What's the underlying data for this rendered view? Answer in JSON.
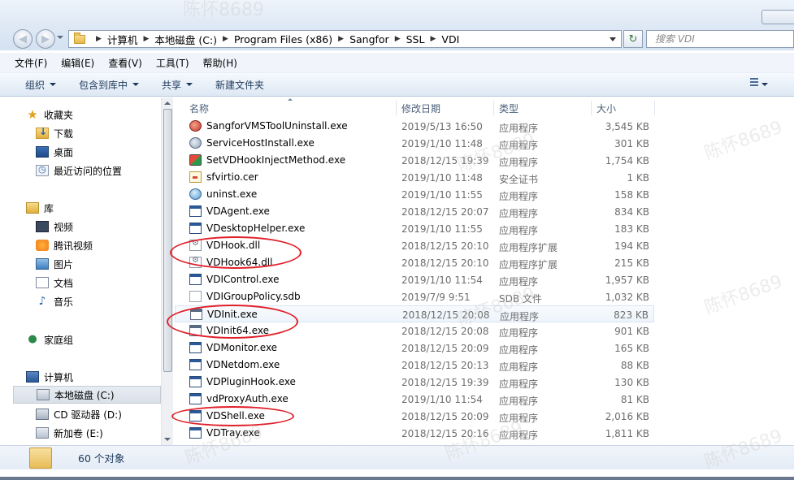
{
  "address": {
    "crumbs": [
      "计算机",
      "本地磁盘 (C:)",
      "Program Files (x86)",
      "Sangfor",
      "SSL",
      "VDI"
    ]
  },
  "search": {
    "placeholder": "搜索 VDI"
  },
  "menu": [
    "文件(F)",
    "编辑(E)",
    "查看(V)",
    "工具(T)",
    "帮助(H)"
  ],
  "toolbar": {
    "organize": "组织",
    "include_library": "包含到库中",
    "share": "共享",
    "new_folder": "新建文件夹"
  },
  "nav": {
    "favorites": "收藏夹",
    "downloads": "下载",
    "desktop": "桌面",
    "recent": "最近访问的位置",
    "libraries": "库",
    "videos": "视频",
    "tencent_video": "腾讯视频",
    "pictures": "图片",
    "documents": "文档",
    "music": "音乐",
    "homegroup": "家庭组",
    "computer": "计算机",
    "local_disk": "本地磁盘 (C:)",
    "cd_drive": "CD 驱动器 (D:)",
    "new_volume": "新加卷 (E:)"
  },
  "columns": {
    "name": "名称",
    "modified": "修改日期",
    "type": "类型",
    "size": "大小"
  },
  "files": [
    {
      "name": "SangforVMSToolUninstall.exe",
      "date": "2019/5/13 16:50",
      "type": "应用程序",
      "size": "3,545 KB",
      "icon": "app-red-icon"
    },
    {
      "name": "ServiceHostInstall.exe",
      "date": "2019/1/10 11:48",
      "type": "应用程序",
      "size": "301 KB",
      "icon": "app-gear-icon"
    },
    {
      "name": "SetVDHookInjectMethod.exe",
      "date": "2018/12/15 19:39",
      "type": "应用程序",
      "size": "1,754 KB",
      "icon": "app-color-icon"
    },
    {
      "name": "sfvirtio.cer",
      "date": "2019/1/10 11:48",
      "type": "安全证书",
      "size": "1 KB",
      "icon": "certificate-icon"
    },
    {
      "name": "uninst.exe",
      "date": "2019/1/10 11:55",
      "type": "应用程序",
      "size": "158 KB",
      "icon": "globe-icon"
    },
    {
      "name": "VDAgent.exe",
      "date": "2018/12/15 20:07",
      "type": "应用程序",
      "size": "834 KB",
      "icon": "window-icon"
    },
    {
      "name": "VDesktopHelper.exe",
      "date": "2019/1/10 11:55",
      "type": "应用程序",
      "size": "183 KB",
      "icon": "window-icon"
    },
    {
      "name": "VDHook.dll",
      "date": "2018/12/15 20:10",
      "type": "应用程序扩展",
      "size": "194 KB",
      "icon": "dll-icon"
    },
    {
      "name": "VDHook64.dll",
      "date": "2018/12/15 20:10",
      "type": "应用程序扩展",
      "size": "215 KB",
      "icon": "dll-icon"
    },
    {
      "name": "VDIControl.exe",
      "date": "2019/1/10 11:54",
      "type": "应用程序",
      "size": "1,957 KB",
      "icon": "window-icon"
    },
    {
      "name": "VDIGroupPolicy.sdb",
      "date": "2019/7/9 9:51",
      "type": "SDB 文件",
      "size": "1,032 KB",
      "icon": "file-icon"
    },
    {
      "name": "VDInit.exe",
      "date": "2018/12/15 20:08",
      "type": "应用程序",
      "size": "823 KB",
      "icon": "exe-icon"
    },
    {
      "name": "VDInit64.exe",
      "date": "2018/12/15 20:08",
      "type": "应用程序",
      "size": "901 KB",
      "icon": "exe-icon"
    },
    {
      "name": "VDMonitor.exe",
      "date": "2018/12/15 20:09",
      "type": "应用程序",
      "size": "165 KB",
      "icon": "window-icon"
    },
    {
      "name": "VDNetdom.exe",
      "date": "2018/12/15 20:13",
      "type": "应用程序",
      "size": "88 KB",
      "icon": "window-icon"
    },
    {
      "name": "VDPluginHook.exe",
      "date": "2018/12/15 19:39",
      "type": "应用程序",
      "size": "130 KB",
      "icon": "window-icon"
    },
    {
      "name": "vdProxyAuth.exe",
      "date": "2019/1/10 11:54",
      "type": "应用程序",
      "size": "81 KB",
      "icon": "window-icon"
    },
    {
      "name": "VDShell.exe",
      "date": "2018/12/15 20:09",
      "type": "应用程序",
      "size": "2,016 KB",
      "icon": "window-icon"
    },
    {
      "name": "VDTray.exe",
      "date": "2018/12/15 20:16",
      "type": "应用程序",
      "size": "1,811 KB",
      "icon": "window-icon"
    }
  ],
  "status": {
    "count": "60 个对象"
  },
  "watermark": "陈怀8689",
  "colors": {
    "annotation": "#e0202a",
    "toolbar_text": "#1e395b"
  }
}
